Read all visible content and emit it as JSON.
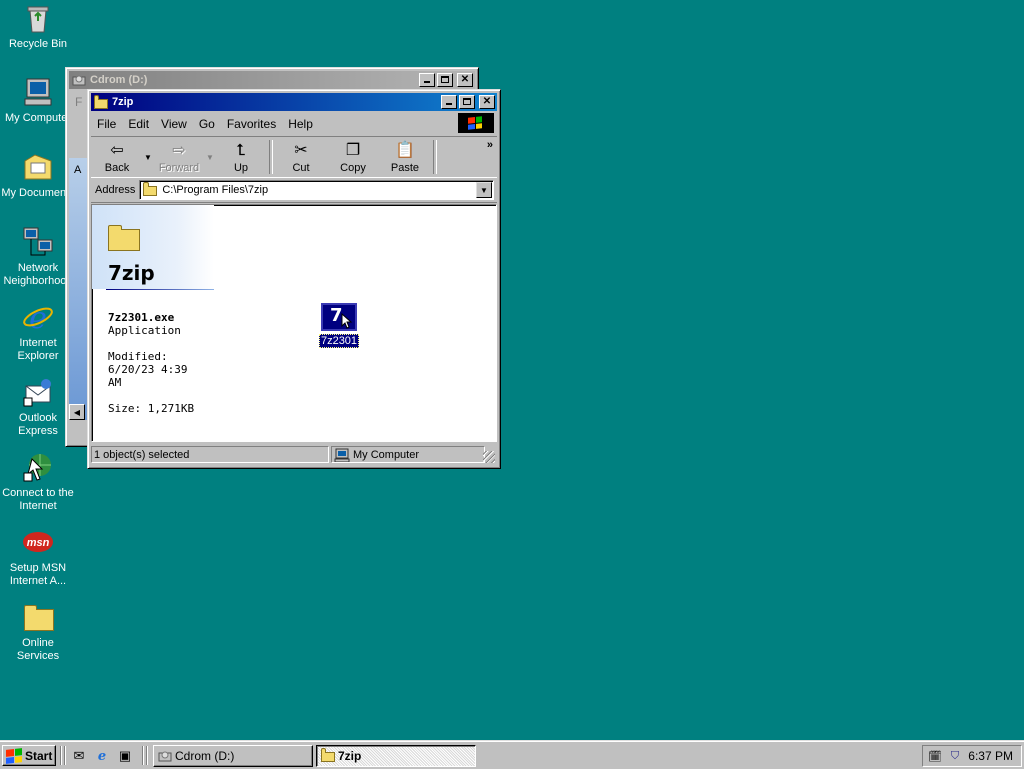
{
  "desktop": {
    "icons": [
      {
        "label": "Recycle Bin"
      },
      {
        "label": "My Computer"
      },
      {
        "label": "My Documents"
      },
      {
        "label": "Network Neighborhood"
      },
      {
        "label": "Internet Explorer"
      },
      {
        "label": "Outlook Express"
      },
      {
        "label": "Connect to the Internet"
      },
      {
        "label": "Setup MSN Internet A..."
      },
      {
        "label": "Online Services"
      }
    ],
    "msn_logo_text": "msn"
  },
  "back_window": {
    "title": "Cdrom (D:)",
    "menu_fragment": "F",
    "address_fragment": "A"
  },
  "window": {
    "title": "7zip",
    "menu": [
      "File",
      "Edit",
      "View",
      "Go",
      "Favorites",
      "Help"
    ],
    "toolbar": {
      "back": "Back",
      "forward": "Forward",
      "up": "Up",
      "cut": "Cut",
      "copy": "Copy",
      "paste": "Paste"
    },
    "address_label": "Address",
    "address_value": "C:\\Program Files\\7zip",
    "webview": {
      "folder_name": "7zip",
      "file_name": "7z2301.exe",
      "file_type": "Application",
      "modified_label": "Modified:",
      "modified_line1": "6/20/23 4:39",
      "modified_line2": "AM",
      "size": "Size: 1,271KB"
    },
    "file": {
      "label": "7z2301",
      "glyph": "7"
    },
    "status": {
      "selection": "1 object(s) selected",
      "zone": "My Computer"
    }
  },
  "taskbar": {
    "start": "Start",
    "tasks": [
      {
        "label": "Cdrom (D:)"
      },
      {
        "label": "7zip"
      }
    ],
    "clock": "6:37 PM"
  },
  "colors": {
    "desktop": "#008080",
    "title_active": "#000080",
    "title_inactive": "#808080",
    "selection": "#000080"
  }
}
